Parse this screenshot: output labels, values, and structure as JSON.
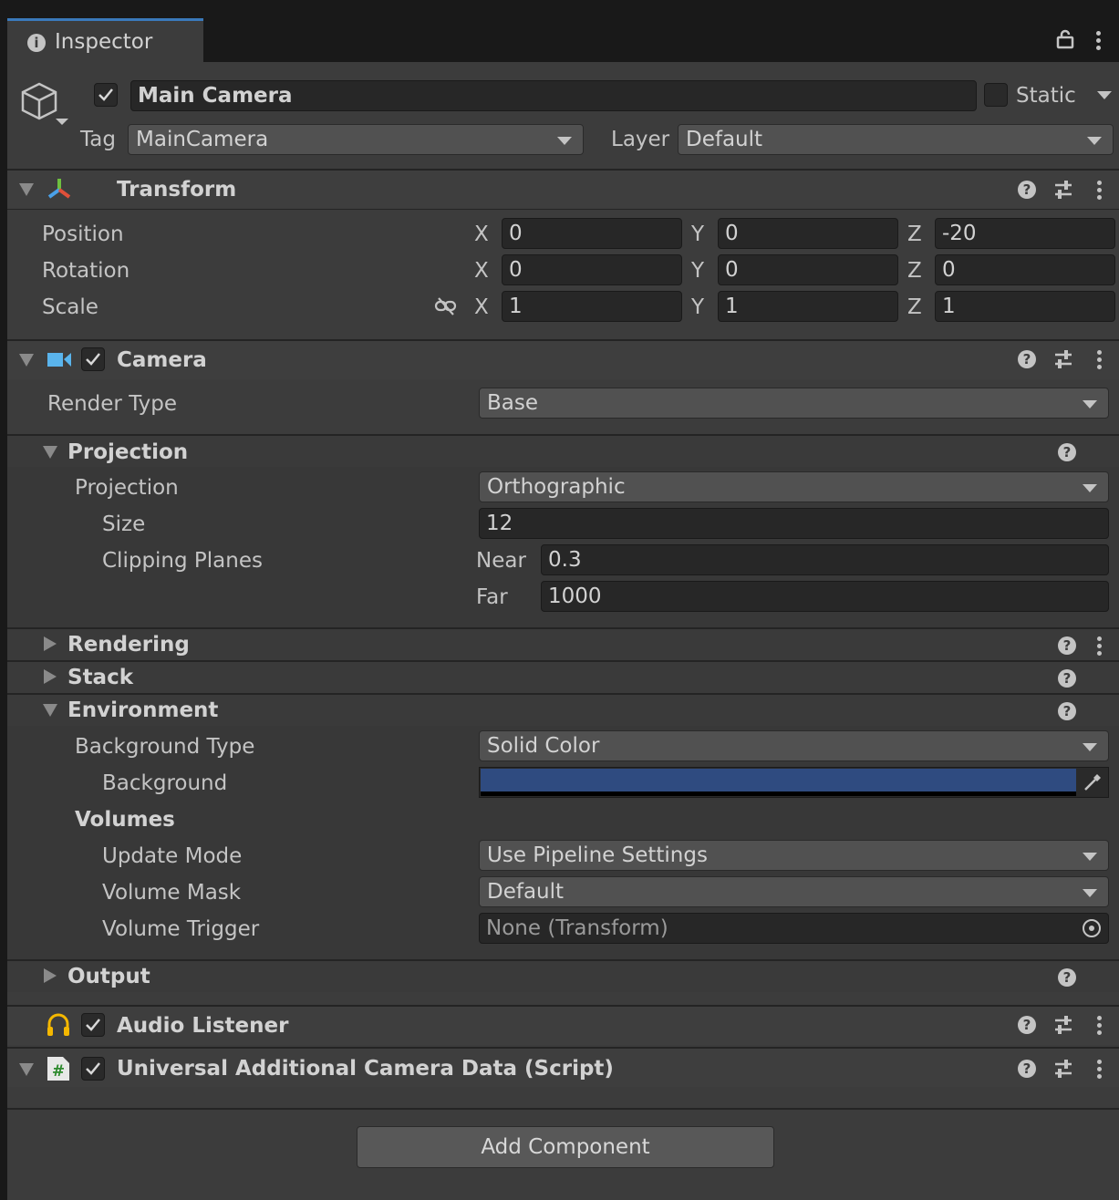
{
  "tab": {
    "title": "Inspector"
  },
  "gameobject": {
    "name": "Main Camera",
    "static_label": "Static",
    "tag_label": "Tag",
    "tag_value": "MainCamera",
    "layer_label": "Layer",
    "layer_value": "Default"
  },
  "transform": {
    "title": "Transform",
    "position": {
      "label": "Position",
      "x": "0",
      "y": "0",
      "z": "-20"
    },
    "rotation": {
      "label": "Rotation",
      "x": "0",
      "y": "0",
      "z": "0"
    },
    "scale": {
      "label": "Scale",
      "x": "1",
      "y": "1",
      "z": "1"
    },
    "axis": {
      "x": "X",
      "y": "Y",
      "z": "Z"
    }
  },
  "camera": {
    "title": "Camera",
    "render_type_label": "Render Type",
    "render_type_value": "Base",
    "projection_section": "Projection",
    "projection_label": "Projection",
    "projection_value": "Orthographic",
    "size_label": "Size",
    "size_value": "12",
    "clipping_label": "Clipping Planes",
    "near_label": "Near",
    "near_value": "0.3",
    "far_label": "Far",
    "far_value": "1000",
    "rendering_section": "Rendering",
    "stack_section": "Stack",
    "environment_section": "Environment",
    "bg_type_label": "Background Type",
    "bg_type_value": "Solid Color",
    "background_label": "Background",
    "background_color": "#2f4b80",
    "volumes_label": "Volumes",
    "update_mode_label": "Update Mode",
    "update_mode_value": "Use Pipeline Settings",
    "volume_mask_label": "Volume Mask",
    "volume_mask_value": "Default",
    "volume_trigger_label": "Volume Trigger",
    "volume_trigger_value": "None (Transform)",
    "output_section": "Output"
  },
  "audio_listener": {
    "title": "Audio Listener"
  },
  "urp_data": {
    "title": "Universal Additional Camera Data (Script)"
  },
  "add_component": "Add Component",
  "help_glyph": "?",
  "colors": {
    "accent": "#3a79bb",
    "panel": "#3c3c3c",
    "field": "#272727"
  }
}
